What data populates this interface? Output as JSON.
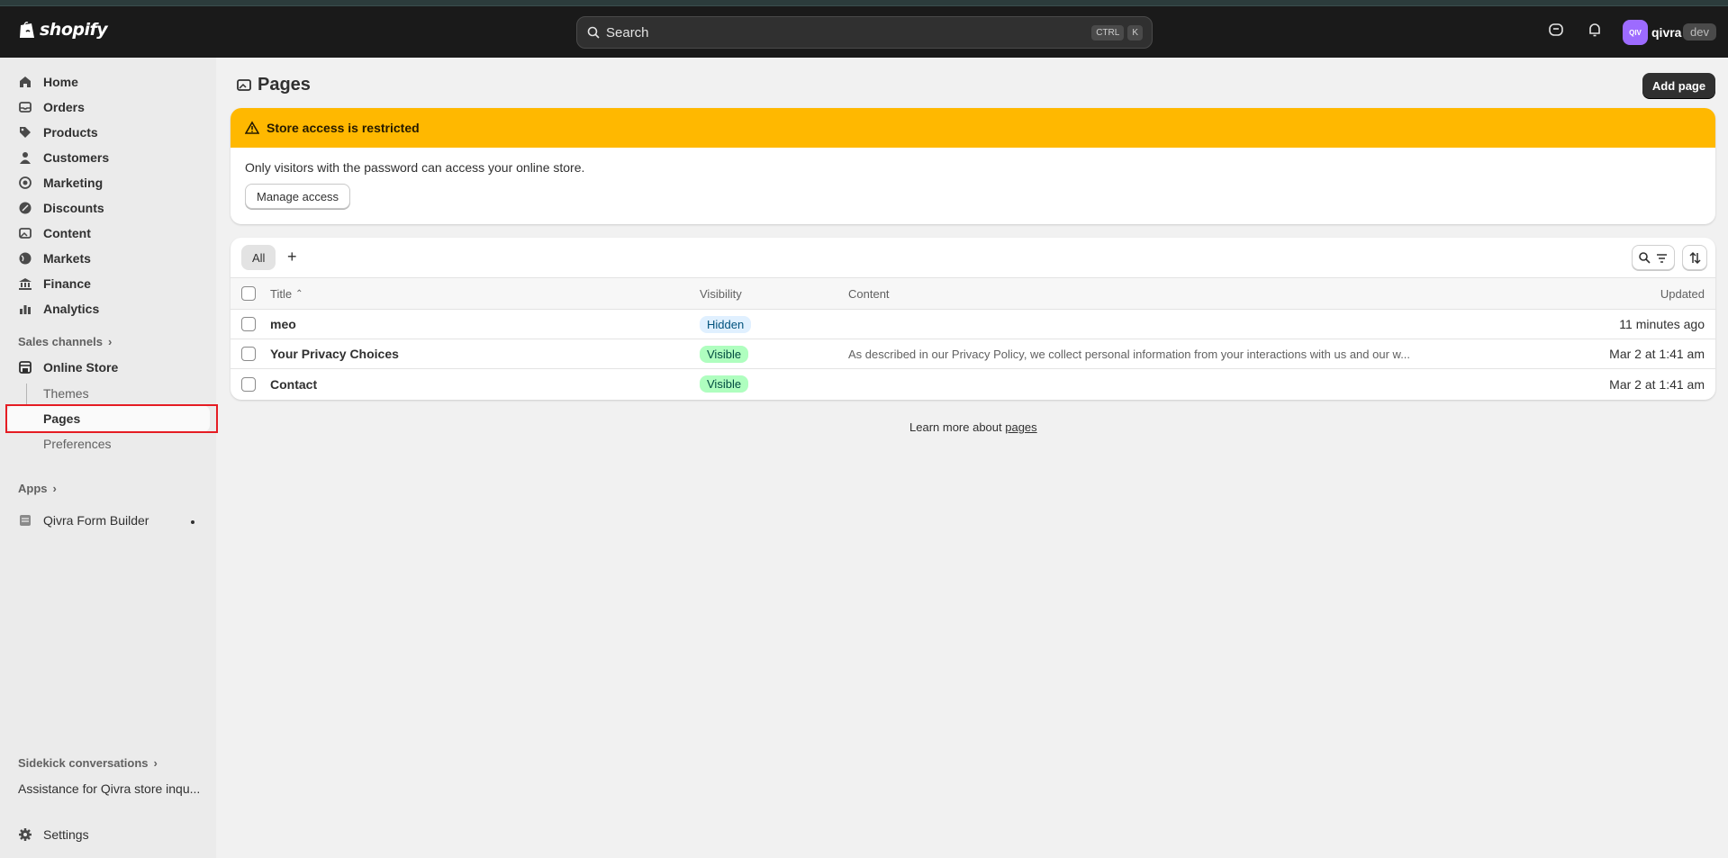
{
  "topbar": {
    "brand": "shopify",
    "search_placeholder": "Search",
    "kbd_ctrl": "CTRL",
    "kbd_k": "K",
    "avatar_initials": "QIV",
    "store_name": "qivra",
    "env_badge": "dev"
  },
  "sidebar": {
    "nav": [
      {
        "label": "Home",
        "icon": "home-icon"
      },
      {
        "label": "Orders",
        "icon": "inbox-icon"
      },
      {
        "label": "Products",
        "icon": "tag-icon"
      },
      {
        "label": "Customers",
        "icon": "person-icon"
      },
      {
        "label": "Marketing",
        "icon": "target-icon"
      },
      {
        "label": "Discounts",
        "icon": "discount-icon"
      },
      {
        "label": "Content",
        "icon": "image-icon"
      },
      {
        "label": "Markets",
        "icon": "globe-icon"
      },
      {
        "label": "Finance",
        "icon": "bank-icon"
      },
      {
        "label": "Analytics",
        "icon": "chart-icon"
      }
    ],
    "sales_channels": "Sales channels",
    "online_store": "Online Store",
    "sub_items": [
      "Themes",
      "Pages",
      "Preferences"
    ],
    "apps": "Apps",
    "app_item": "Qivra Form Builder",
    "sidekick": "Sidekick conversations",
    "sidekick_item": "Assistance for Qivra store inqu...",
    "settings": "Settings"
  },
  "main": {
    "title": "Pages",
    "add_button": "Add page",
    "banner": {
      "title": "Store access is restricted",
      "text": "Only visitors with the password can access your online store.",
      "button": "Manage access"
    },
    "tabs": [
      "All"
    ],
    "table": {
      "headers": {
        "title": "Title",
        "visibility": "Visibility",
        "content": "Content",
        "updated": "Updated"
      },
      "rows": [
        {
          "title": "meo",
          "visibility": "Hidden",
          "content": "",
          "updated": "11 minutes ago"
        },
        {
          "title": "Your Privacy Choices",
          "visibility": "Visible",
          "content": "As described in our Privacy Policy, we collect personal information from your interactions with us and our w...",
          "updated": "Mar 2 at 1:41 am"
        },
        {
          "title": "Contact",
          "visibility": "Visible",
          "content": "",
          "updated": "Mar 2 at 1:41 am"
        }
      ]
    },
    "learn_prefix": "Learn more about ",
    "learn_link": "pages"
  },
  "colors": {
    "topbar": "#1a1a1a",
    "banner_warning": "#ffb800",
    "badge_hidden": "#e0f0ff",
    "badge_visible": "#affebf",
    "primary_button": "#303030",
    "highlight_outline": "#e51c23"
  }
}
